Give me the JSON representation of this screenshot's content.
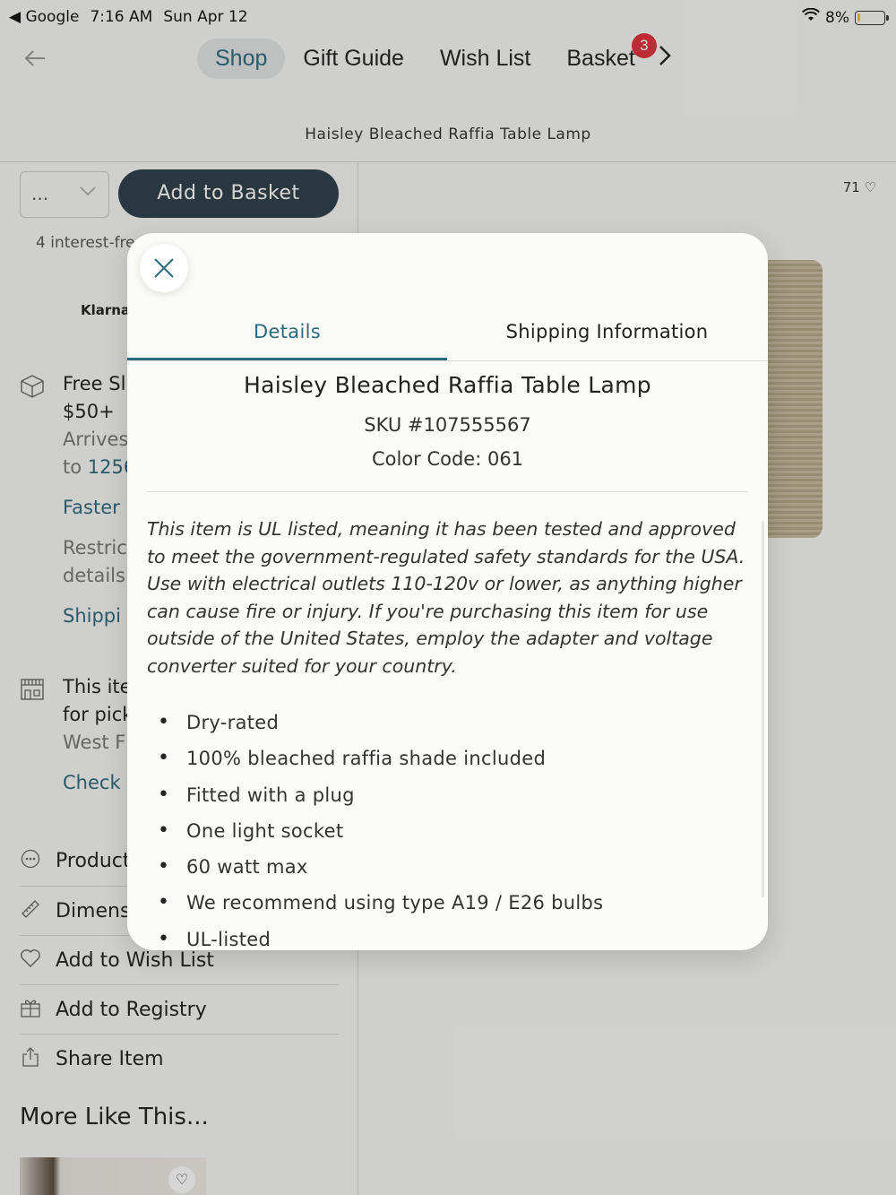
{
  "status_bar": {
    "app": "◀ Google",
    "time": "7:16 AM",
    "date": "Sun Apr 12",
    "battery": "8%",
    "battery_fill": 0.08
  },
  "nav": {
    "back_icon": "arrow-left-icon",
    "tabs": [
      "Shop",
      "Gift Guide",
      "Wish List",
      "Basket"
    ],
    "active_tab": "Shop",
    "basket_count": "3",
    "chevron": "›"
  },
  "page": {
    "title": "Haisley Bleached Raffia Table Lamp"
  },
  "left": {
    "qty_value": "...",
    "add_button": "Add to Basket",
    "interest": "4 interest-fre",
    "klarna": "Klarna.",
    "shipping": {
      "line1": "Free Sl",
      "line2": "$50+",
      "line3": "Arrives",
      "line4": "to 1256",
      "line5": "Faster",
      "line6": "Restric",
      "line7": "details",
      "line8": "Shippi"
    },
    "pickup": {
      "line1": "This ite",
      "line2": "for pick",
      "line3": "West F",
      "line4": "Check"
    },
    "menu": [
      "Product",
      "Dimens",
      "Add to Wish List",
      "Add to Registry",
      "Share Item"
    ],
    "more_like": "More Like This..."
  },
  "right": {
    "likes": "71 ♡"
  },
  "modal": {
    "close_label": "✕",
    "tabs": [
      "Details",
      "Shipping Information"
    ],
    "active_tab": "Details",
    "product_name": "Haisley Bleached Raffia Table Lamp",
    "sku": "SKU #107555567",
    "color_code": "Color Code: 061",
    "description": "This item is UL listed, meaning it has been tested and approved to meet the government-regulated safety standards for the USA. Use with electrical outlets 110-120v or lower, as anything higher can cause fire or injury. If you're purchasing this item for use outside of the United States, employ the adapter and voltage converter suited for your country.",
    "bullets": [
      "Dry-rated",
      "100% bleached raffia shade included",
      "Fitted with a plug",
      "One light socket",
      "60 watt max",
      "We recommend using type A19 / E26 bulbs",
      "UL-listed"
    ]
  },
  "colors": {
    "accent": "#2c6a7f",
    "button": "#2d3e4a",
    "badge": "#e0303a"
  }
}
